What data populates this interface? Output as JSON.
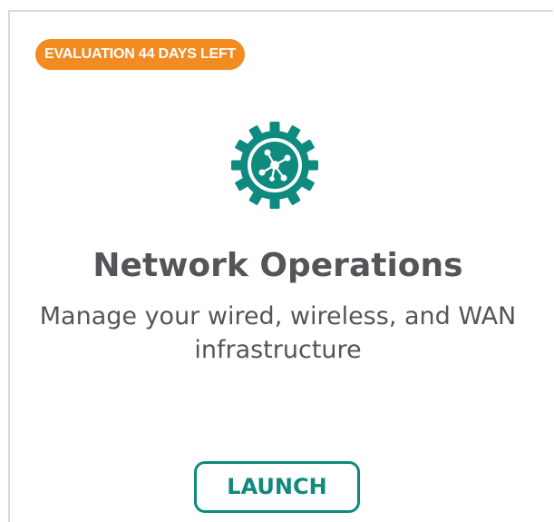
{
  "card": {
    "badge_text": "EVALUATION 44 DAYS LEFT",
    "icon": "network-gear-icon",
    "title": "Network Operations",
    "description": "Manage your wired, wireless, and WAN infrastructure",
    "launch_label": "LAUNCH"
  },
  "colors": {
    "badge": "#f28b22",
    "accent": "#0f8a7e",
    "text": "#555559",
    "border": "#d9d9d9"
  }
}
